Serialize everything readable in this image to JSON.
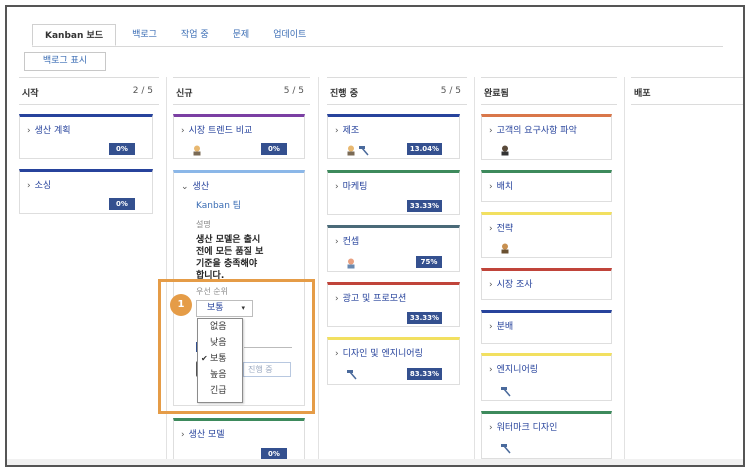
{
  "tabs": [
    "Kanban 보드",
    "백로그",
    "작업 중",
    "문제",
    "업데이트"
  ],
  "backlog_button": "백로그 표시",
  "columns": [
    {
      "title": "시작",
      "count": "2 / 5"
    },
    {
      "title": "신규",
      "count": "5 / 5"
    },
    {
      "title": "진행 중",
      "count": "5 / 5"
    },
    {
      "title": "완료됨",
      "count": ""
    },
    {
      "title": "배포",
      "count": ""
    }
  ],
  "col_start": [
    {
      "title": "생산 계획",
      "pct": "0%",
      "color": "#27439c"
    },
    {
      "title": "소싱",
      "pct": "0%",
      "color": "#27439c"
    }
  ],
  "col_new": {
    "card1": {
      "title": "시장 트렌드 비교",
      "pct": "0%",
      "color": "#7b3fa3",
      "icon": "person-icon"
    },
    "expanded": {
      "title": "생산",
      "team": "Kanban 팀",
      "desc_label": "설명",
      "desc_lines": [
        "생산 모델은 출시",
        "전에 모든 품질 보",
        "기준을 충족해야",
        "합니다."
      ],
      "priority_label": "우선 순위",
      "priority_value": "보통",
      "status_text": "진행 중",
      "color": "#8bb7e8"
    },
    "card3": {
      "title": "생산 모델",
      "pct": "0%",
      "color": "#3d8a5c"
    }
  },
  "priority_options": [
    "없음",
    "낮음",
    "보통",
    "높음",
    "긴급"
  ],
  "priority_selected": "보통",
  "callout_number": "1",
  "col_progress": [
    {
      "title": "제조",
      "pct": "13.04%",
      "color": "#27439c",
      "icons": [
        "person-icon",
        "hammer-icon"
      ]
    },
    {
      "title": "마케팅",
      "pct": "33.33%",
      "color": "#3d8a5c",
      "icons": []
    },
    {
      "title": "컨셉",
      "pct": "75%",
      "color": "#4a6a78",
      "icons": [
        "person-icon"
      ]
    },
    {
      "title": "광고 및 프로모션",
      "pct": "33.33%",
      "color": "#c0443a",
      "icons": []
    },
    {
      "title": "디자인 및 엔지니어링",
      "pct": "83.33%",
      "color": "#f2e060",
      "icons": [
        "hammer-icon"
      ]
    }
  ],
  "col_done": [
    {
      "title": "고객의 요구사항 파악",
      "color": "#d9774a",
      "icons": [
        "person-icon"
      ]
    },
    {
      "title": "배치",
      "color": "#3d8a5c",
      "icons": []
    },
    {
      "title": "전략",
      "color": "#f2e060",
      "icons": [
        "person-icon"
      ]
    },
    {
      "title": "시장 조사",
      "color": "#c0443a",
      "icons": []
    },
    {
      "title": "분배",
      "color": "#27439c",
      "icons": []
    },
    {
      "title": "엔지니어링",
      "color": "#f2e060",
      "icons": [
        "hammer-icon"
      ]
    },
    {
      "title": "워터마크 디자인",
      "color": "#3d8a5c",
      "icons": [
        "hammer-icon"
      ]
    }
  ]
}
